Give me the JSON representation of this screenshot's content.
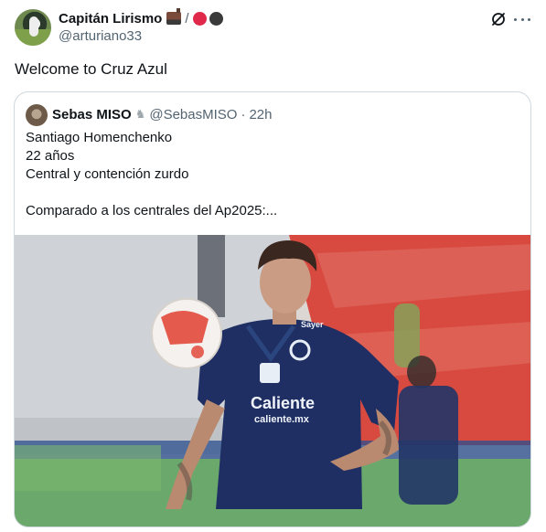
{
  "author": {
    "display_name": "Capitán Lirismo",
    "handle": "@arturiano33",
    "emoji": [
      "train-emoji",
      "red-circle-emoji",
      "black-circle-emoji"
    ],
    "separator": "/"
  },
  "tweet": {
    "text": "Welcome to Cruz Azul"
  },
  "quoted": {
    "display_name": "Sebas MISO",
    "badge_icon": "goat-emoji",
    "handle": "@SebasMISO",
    "separator": "·",
    "time": "22h",
    "lines": [
      "Santiago Homenchenko",
      "22 años",
      "Central y contención zurdo",
      "",
      "Comparado a los centrales del Ap2025:..."
    ],
    "photo": {
      "jersey_sponsor": "Caliente",
      "jersey_sponsor_url": "caliente.mx",
      "jersey_sleeve": "Sayer"
    }
  },
  "icons": {
    "grok": "grok-icon",
    "more": "more-icon"
  },
  "colors": {
    "text_primary": "#0f1419",
    "text_secondary": "#536471",
    "border": "#cfd9de",
    "jersey_navy": "#1f2f63",
    "stadium_red": "#d6453c"
  }
}
